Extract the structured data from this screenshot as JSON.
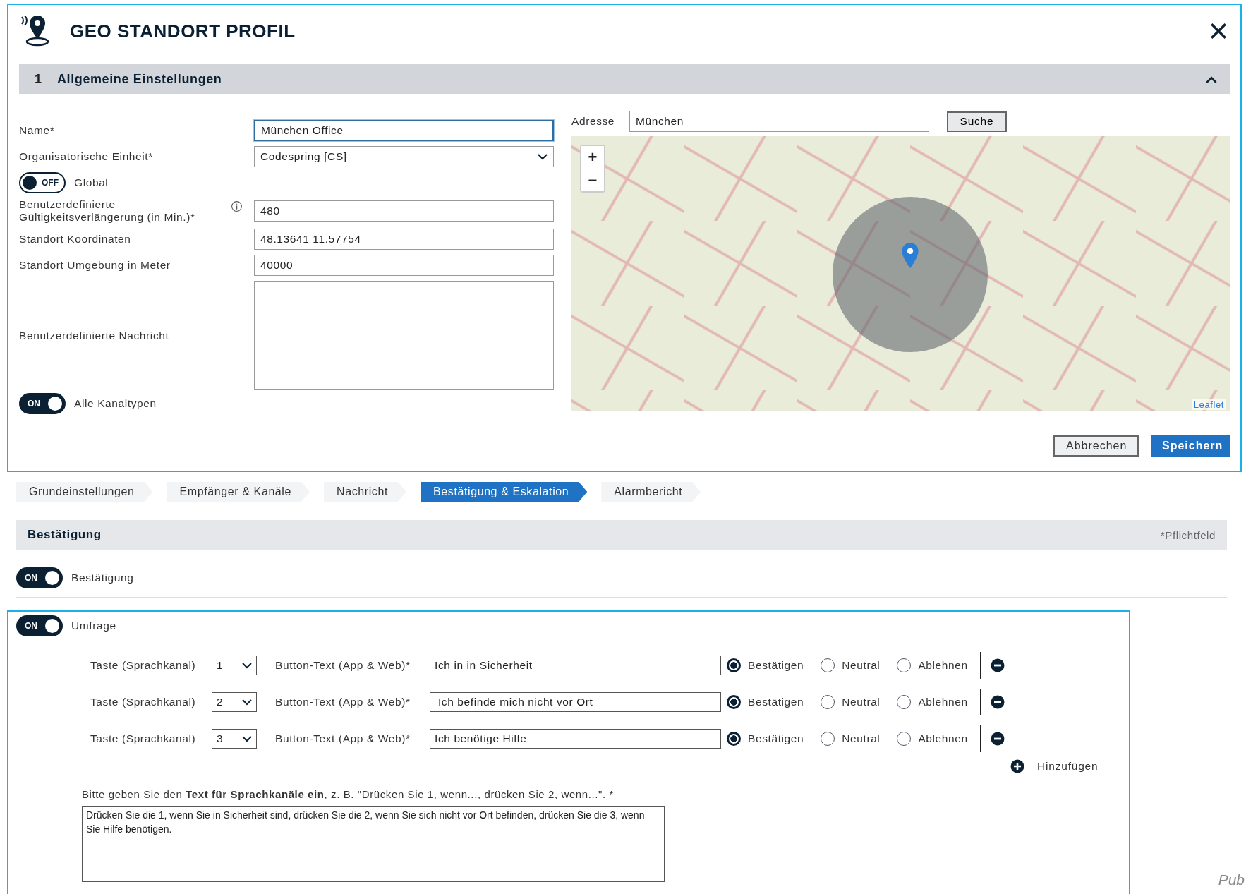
{
  "dialog": {
    "title": "GEO STANDORT PROFIL",
    "section": {
      "number": "1",
      "title": "Allgemeine Einstellungen",
      "expanded": true
    },
    "fields": [
      {
        "kind": "input",
        "label": "Name*",
        "value": "München Office",
        "focused": true
      },
      {
        "kind": "select",
        "label": "Organisatorische Einheit*",
        "value": "Codespring [CS]"
      },
      {
        "kind": "toggle",
        "label": "Global",
        "on": false,
        "state_text": "OFF"
      },
      {
        "kind": "input",
        "label": "Benutzerdefinierte Gültigkeitsverlängerung (in Min.)*",
        "value": "480",
        "info": true
      },
      {
        "kind": "input",
        "label": "Standort Koordinaten",
        "value": "48.13641 11.57754"
      },
      {
        "kind": "input",
        "label": "Standort Umgebung in Meter",
        "value": "40000"
      },
      {
        "kind": "textarea",
        "label": "Benutzerdefinierte Nachricht"
      },
      {
        "kind": "toggle",
        "label": "Alle Kanaltypen",
        "on": true,
        "state_text": "ON"
      }
    ],
    "address": {
      "label": "Adresse",
      "value": "München",
      "button": "Suche"
    },
    "map": {
      "zoom_in": "+",
      "zoom_out": "−",
      "attribution": "Leaflet"
    },
    "buttons": [
      {
        "label": "Abbrechen",
        "kind": "secondary"
      },
      {
        "label": "Speichern",
        "kind": "primary"
      }
    ]
  },
  "steps": [
    {
      "label": "Grundeinstellungen",
      "selected": false
    },
    {
      "label": "Empfänger & Kanäle",
      "selected": false
    },
    {
      "label": "Nachricht",
      "selected": false
    },
    {
      "label": "Bestätigung & Eskalation",
      "selected": true
    },
    {
      "label": "Alarmbericht",
      "selected": false
    }
  ],
  "section": {
    "title": "Bestätigung",
    "note": "*Pflichtfeld"
  },
  "confirm_toggle": {
    "label": "Bestätigung",
    "on": true,
    "state_text": "ON"
  },
  "survey": {
    "toggle": {
      "label": "Umfrage",
      "on": true,
      "state_text": "ON"
    },
    "rows": [
      {
        "key_label": "Taste (Sprachkanal)",
        "key": "1",
        "text_label": "Button-Text (App & Web)*",
        "text": "Ich in in Sicherheit",
        "options": [
          {
            "label": "Bestätigen",
            "selected": true
          },
          {
            "label": "Neutral",
            "selected": false
          },
          {
            "label": "Ablehnen",
            "selected": false
          }
        ]
      },
      {
        "key_label": "Taste (Sprachkanal)",
        "key": "2",
        "text_label": "Button-Text (App & Web)*",
        "text": " Ich befinde mich nicht vor Ort",
        "options": [
          {
            "label": "Bestätigen",
            "selected": true
          },
          {
            "label": "Neutral",
            "selected": false
          },
          {
            "label": "Ablehnen",
            "selected": false
          }
        ]
      },
      {
        "key_label": "Taste (Sprachkanal)",
        "key": "3",
        "text_label": "Button-Text (App & Web)*",
        "text": "Ich benötige Hilfe",
        "options": [
          {
            "label": "Bestätigen",
            "selected": true
          },
          {
            "label": "Neutral",
            "selected": false
          },
          {
            "label": "Ablehnen",
            "selected": false
          }
        ]
      }
    ],
    "add": "Hinzufügen",
    "instruction": "Bitte geben Sie den **Text für Sprachkanäle ein**, z. B. \"Drücken Sie 1, wenn..., drücken Sie 2, wenn...\". *",
    "voice_text": "Drücken Sie die 1, wenn Sie in Sicherheit sind, drücken Sie die 2, wenn Sie sich nicht vor Ort befinden, drücken Sie die 3, wenn Sie Hilfe benötigen."
  },
  "corner_text": "Pub"
}
